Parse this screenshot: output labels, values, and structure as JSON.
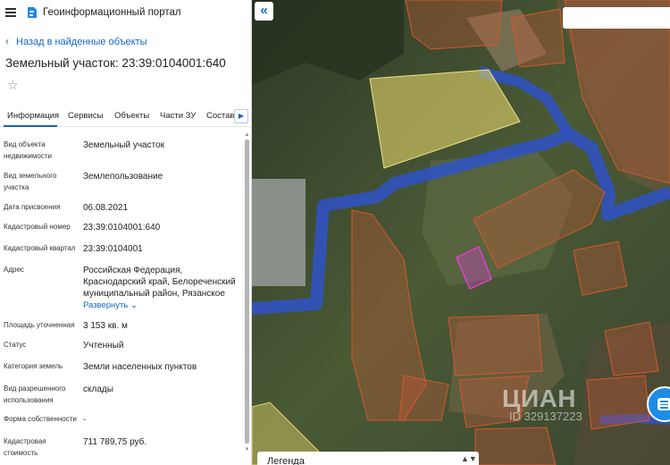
{
  "header": {
    "app_title": "Геоинформационный портал"
  },
  "nav": {
    "back_label": "Назад в найденные объекты"
  },
  "object": {
    "title": "Земельный участок: 23:39:0104001:640"
  },
  "tabs": [
    {
      "label": "Информация"
    },
    {
      "label": "Сервисы"
    },
    {
      "label": "Объекты"
    },
    {
      "label": "Части ЗУ"
    },
    {
      "label": "Состав"
    }
  ],
  "fields": [
    {
      "label": "Вид объекта недвижимости",
      "value": "Земельный участок"
    },
    {
      "label": "Вид земельного участка",
      "value": "Землепользование"
    },
    {
      "label": "Дата присвоения",
      "value": "06.08.2021"
    },
    {
      "label": "Кадастровый номер",
      "value": "23:39:0104001:640"
    },
    {
      "label": "Кадастровый квартал",
      "value": "23:39:0104001"
    },
    {
      "label": "Адрес",
      "value": "Российская Федерация, Краснодарский край, Белореченский муниципальный район, Рязанское",
      "expand_label": "Развернуть"
    },
    {
      "label": "Площадь уточненная",
      "value": "3 153 кв. м"
    },
    {
      "label": "Статус",
      "value": "Учтенный"
    },
    {
      "label": "Категория земель",
      "value": "Земли населенных пунктов"
    },
    {
      "label": "Вид разрешенного использования",
      "value": "склады"
    },
    {
      "label": "Форма собственности",
      "value": "-"
    },
    {
      "label": "Кадастровая стоимость",
      "value": "711 789,75 руб."
    }
  ],
  "map": {
    "legend_label": "Легенда",
    "watermark_brand": "ЦИАН",
    "watermark_id": "ID 329137223",
    "colors": {
      "parcel_outline": "#d4582a",
      "selected_parcel": "#e040d0",
      "highlight_parcel": "#e3d46a",
      "waterway": "#2f52c9",
      "accent": "#1565c0"
    }
  },
  "icons": [
    "menu-icon",
    "portal-logo-icon",
    "chevron-left-icon",
    "star-icon",
    "chevron-right-icon",
    "collapse-panel-icon",
    "chevron-down-icon",
    "chevron-up-icon",
    "chat-icon"
  ]
}
